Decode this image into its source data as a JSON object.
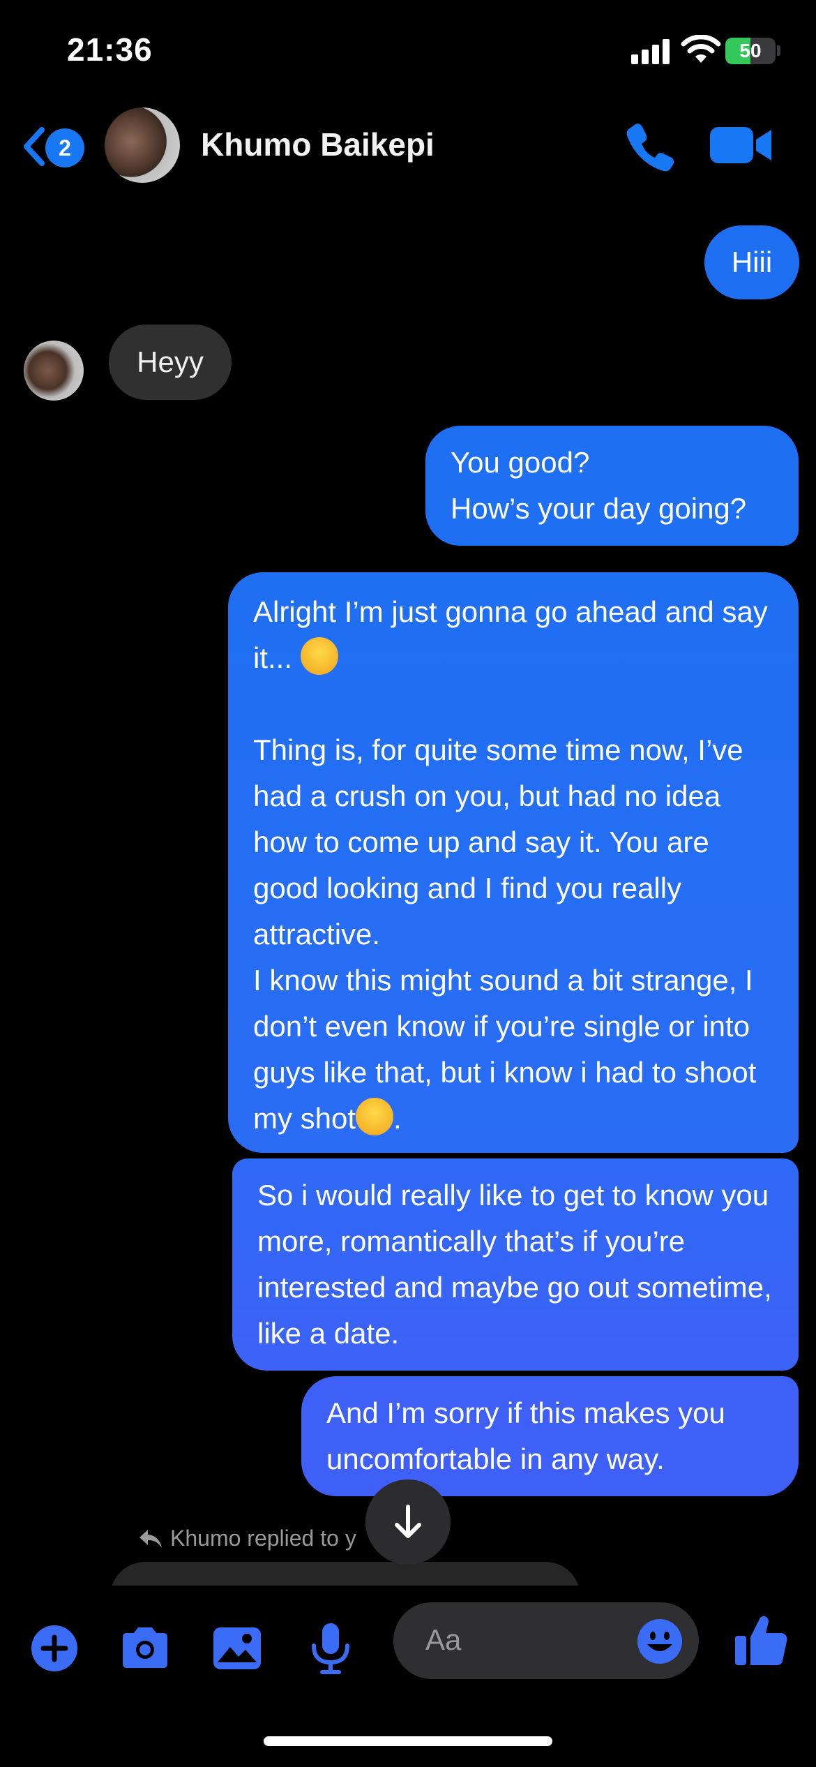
{
  "status_bar": {
    "time": "21:36",
    "battery_text": "50",
    "battery_level": 0.5
  },
  "header": {
    "back_badge": "2",
    "contact_name": "Khumo Baikepi"
  },
  "messages": {
    "m1": "Hiii",
    "m2": "Heyy",
    "m3": "You good?\nHow’s your day going?",
    "m4_part1": "Alright I’m just gonna go ahead and say it... ",
    "m4_part2": "\n\nThing is, for quite some time now, I’ve had a crush on you, but had no idea how to come up and say it. You are good looking and I find you really attractive.\nI know this might sound a bit strange, I don’t even know if you’re single or into guys like that, but i know i had to shoot my shot",
    "m4_part3": ".",
    "m5": "So i would really like to get to know you more, romantically that’s if you’re interested and maybe go out sometime, like a date.",
    "m6": "And I’m sorry if this makes you uncomfortable in any way."
  },
  "reply_note": "Khumo replied to y",
  "composer": {
    "placeholder": "Aa"
  },
  "colors": {
    "accent": "#1f6ff2",
    "outgoing_bubble": "#1f6ff2",
    "outgoing_bubble_late": "#3d62f6",
    "incoming_bubble": "#303030",
    "background": "#000000"
  },
  "icons": [
    "back-chevron-icon",
    "phone-icon",
    "video-camera-icon",
    "plus-icon",
    "camera-icon",
    "photo-icon",
    "microphone-icon",
    "emoji-icon",
    "thumbs-up-icon",
    "reply-arrow-icon",
    "arrow-down-icon"
  ]
}
